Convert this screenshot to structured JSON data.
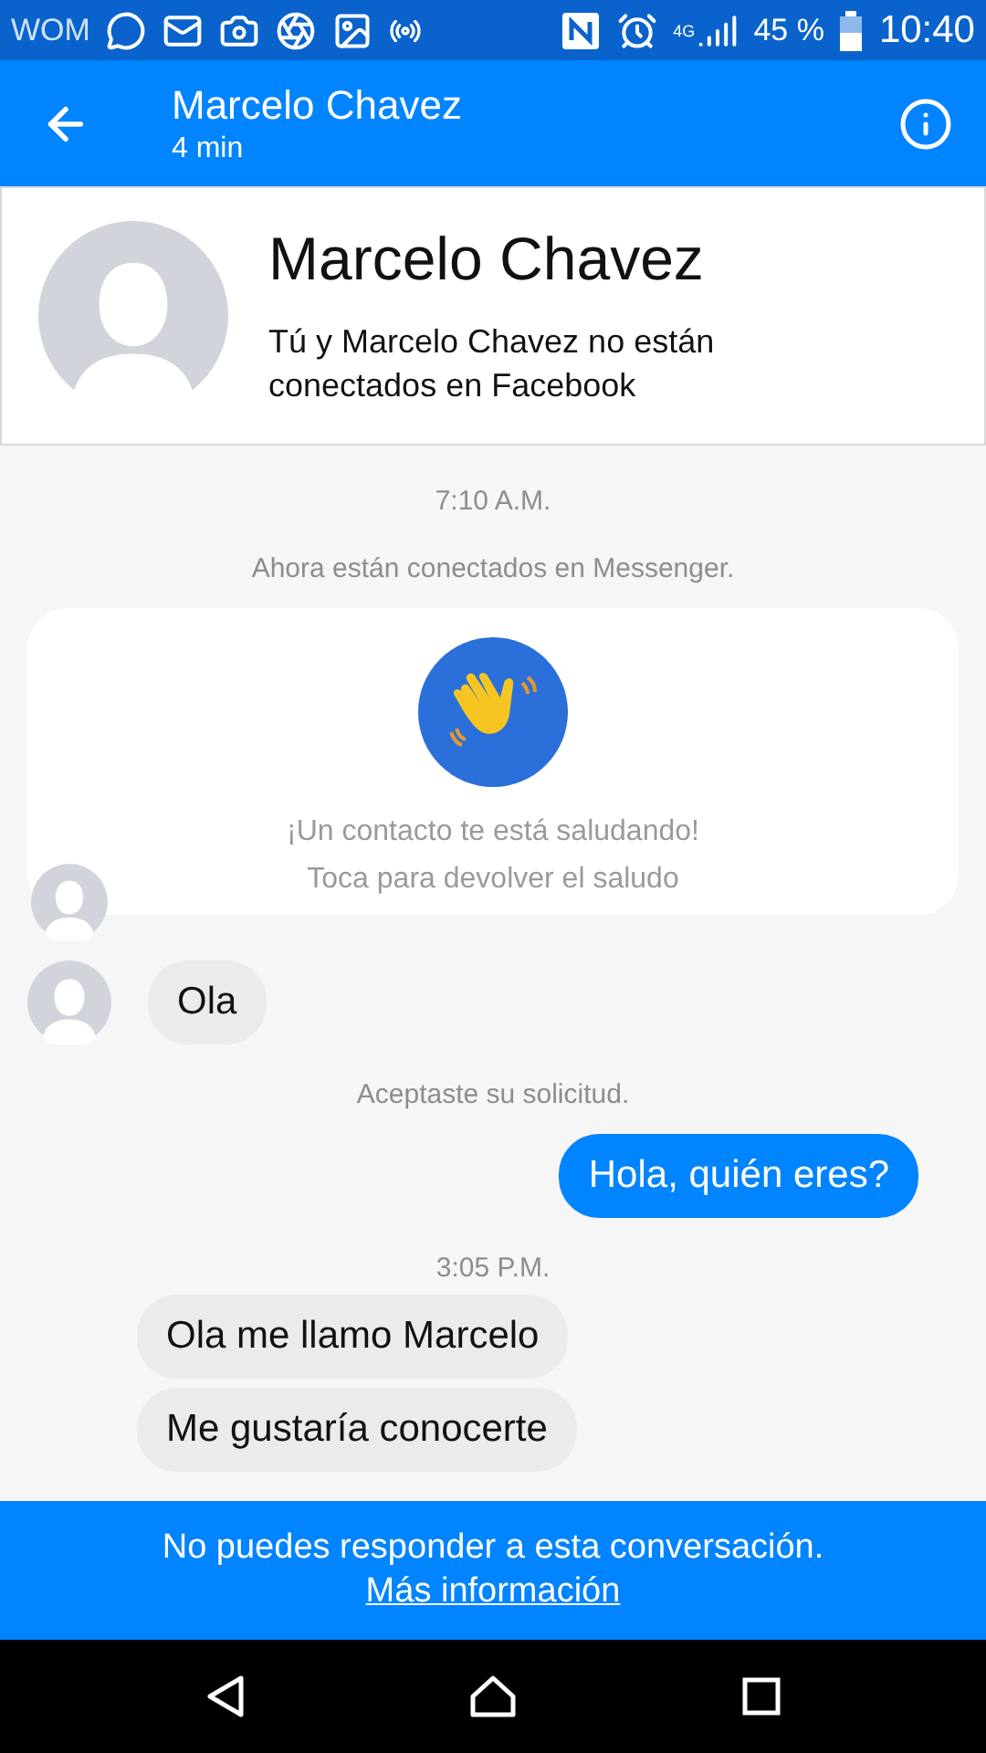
{
  "status_bar": {
    "carrier": "WOM",
    "network": "4G",
    "battery": "45 %",
    "time": "10:40"
  },
  "header": {
    "title": "Marcelo Chavez",
    "subtitle": "4 min"
  },
  "profile": {
    "name": "Marcelo Chavez",
    "note": "Tú y Marcelo Chavez no están conectados en Facebook"
  },
  "messages": [
    {
      "kind": "timestamp",
      "text": "7:10 A.M."
    },
    {
      "kind": "system",
      "text": "Ahora están conectados en Messenger."
    },
    {
      "kind": "wave",
      "lines": [
        "¡Un contacto te está saludando!",
        "Toca para devolver el saludo"
      ],
      "avatar": true
    },
    {
      "kind": "incoming",
      "text": "Ola",
      "avatar": true
    },
    {
      "kind": "system",
      "text": "Aceptaste su solicitud."
    },
    {
      "kind": "outgoing",
      "text": "Hola, quién eres?"
    },
    {
      "kind": "timestamp",
      "text": "3:05 P.M."
    },
    {
      "kind": "incoming",
      "text": "Ola me llamo Marcelo",
      "avatar": false
    },
    {
      "kind": "incoming",
      "text": "Me gustaría conocerte",
      "avatar": false
    }
  ],
  "banner": {
    "text": "No puedes responder a esta conversación.",
    "link": "Más información"
  }
}
